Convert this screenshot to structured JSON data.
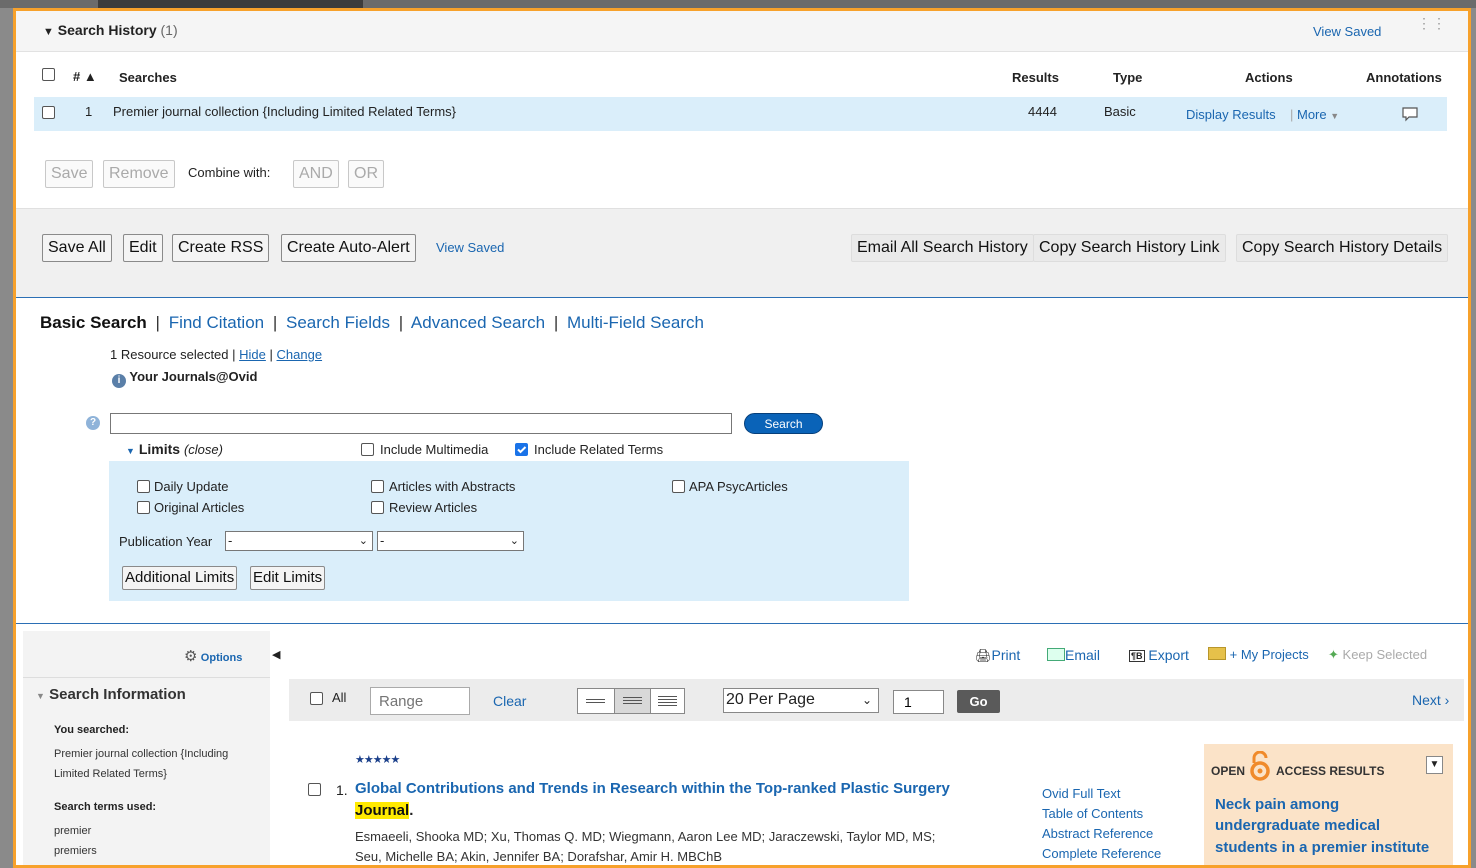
{
  "history": {
    "title": "Search History",
    "count": "(1)",
    "view_saved": "View Saved",
    "col_num": "#",
    "col_searches": "Searches",
    "col_results": "Results",
    "col_type": "Type",
    "col_actions": "Actions",
    "col_annotations": "Annotations",
    "rows": [
      {
        "num": "1",
        "search": "Premier journal collection {Including Limited Related Terms}",
        "results": "4444",
        "type": "Basic",
        "display_results": "Display Results",
        "more": "More"
      }
    ],
    "save": "Save",
    "remove": "Remove",
    "combine_with": "Combine with:",
    "and": "AND",
    "or": "OR"
  },
  "toolbar": {
    "save_all": "Save All",
    "edit": "Edit",
    "create_rss": "Create RSS",
    "create_auto_alert": "Create Auto-Alert",
    "view_saved": "View Saved",
    "email_all": "Email All Search History",
    "copy_link": "Copy Search History Link",
    "copy_details": "Copy Search History Details"
  },
  "search_tabs": {
    "basic": "Basic Search",
    "find_citation": "Find Citation",
    "search_fields": "Search Fields",
    "advanced": "Advanced Search",
    "multi_field": "Multi-Field Search"
  },
  "resources": {
    "selected": "1 Resource selected |",
    "hide": "Hide",
    "sep": "|",
    "change": "Change",
    "name": "Your Journals@Ovid"
  },
  "search": {
    "value": "",
    "button": "Search"
  },
  "limits": {
    "label": "Limits",
    "close": "(close)",
    "include_multimedia": "Include Multimedia",
    "include_multimedia_checked": false,
    "include_related": "Include Related Terms",
    "include_related_checked": true,
    "daily_update": "Daily Update",
    "articles_abstracts": "Articles with Abstracts",
    "apa_psycarticles": "APA PsycArticles",
    "original_articles": "Original Articles",
    "review_articles": "Review Articles",
    "publication_year": "Publication Year",
    "year_from": "-",
    "year_to": "-",
    "additional_limits": "Additional Limits",
    "edit_limits": "Edit Limits"
  },
  "sidebar": {
    "options": "Options",
    "search_information": "Search Information",
    "you_searched": "You searched:",
    "you_searched_value_1": "Premier journal collection {Including",
    "you_searched_value_2": "Limited Related Terms}",
    "terms_used": "Search terms used:",
    "terms": [
      "premier",
      "premiers"
    ]
  },
  "result_actions": {
    "print": "Print",
    "email": "Email",
    "export": "Export",
    "my_projects": "+ My Projects",
    "keep_selected": "Keep Selected"
  },
  "results_bar": {
    "all": "All",
    "range_placeholder": "Range",
    "clear": "Clear",
    "per_page": "20 Per Page",
    "page": "1",
    "go": "Go",
    "next": "Next ›"
  },
  "result": {
    "stars": "★★★★★",
    "number": "1.",
    "title_1": "Global Contributions and Trends in Research within the Top-ranked Plastic Surgery",
    "title_highlight": "Journal",
    "title_end": ".",
    "authors_1": "Esmaeeli, Shooka MD; Xu, Thomas Q. MD; Wiegmann, Aaron Lee MD; Jaraczewski, Taylor MD, MS;",
    "authors_2": "Seu, Michelle BA; Akin, Jennifer BA; Dorafshar, Amir H. MBChB",
    "links": [
      "Ovid Full Text",
      "Table of Contents",
      "Abstract Reference",
      "Complete Reference"
    ]
  },
  "open_access": {
    "open": "OPEN",
    "access_results": "ACCESS RESULTS",
    "article_1": "Neck pain among",
    "article_2": "undergraduate medical",
    "article_3": "students in a premier institute"
  },
  "colors": {
    "border": "#f7a12b",
    "link": "#1a66b0",
    "row_highlight": "#daeefa",
    "limits_bg": "#daeefa",
    "search_btn": "#0a63b8"
  }
}
